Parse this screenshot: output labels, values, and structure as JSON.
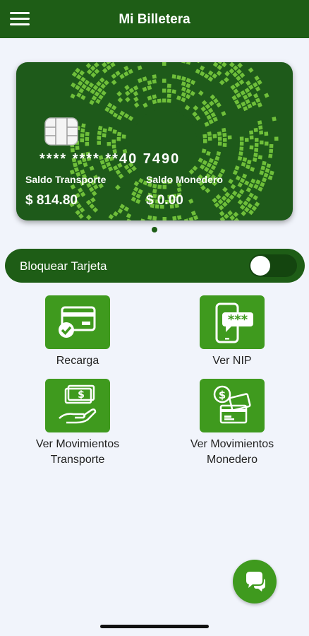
{
  "header": {
    "title": "Mi Billetera",
    "menu_icon": "hamburger-menu-icon"
  },
  "card": {
    "number": "**** **** **40 7490",
    "transport_label": "Saldo Transporte",
    "transport_balance": "$ 814.80",
    "wallet_label": "Saldo Monedero",
    "wallet_balance": "$ 0.00",
    "background_color": "#1e5a1a",
    "pattern_color": "#6fbf3a"
  },
  "carousel": {
    "pages": 1,
    "active": 1
  },
  "block_card": {
    "label": "Bloquear Tarjeta",
    "enabled": false
  },
  "actions": [
    {
      "label": "Recarga",
      "icon": "card-check-icon"
    },
    {
      "label": "Ver NIP",
      "icon": "phone-pin-icon"
    },
    {
      "label": "Ver Movimientos\nTransporte",
      "icon": "cash-hand-icon"
    },
    {
      "label": "Ver Movimientos\nMonedero",
      "icon": "dollar-cards-icon"
    }
  ],
  "chat_button": {
    "icon": "chat-bubbles-icon"
  },
  "colors": {
    "brand_dark": "#1e5d16",
    "brand_light": "#3f9a1e",
    "background": "#f1f4fb"
  }
}
